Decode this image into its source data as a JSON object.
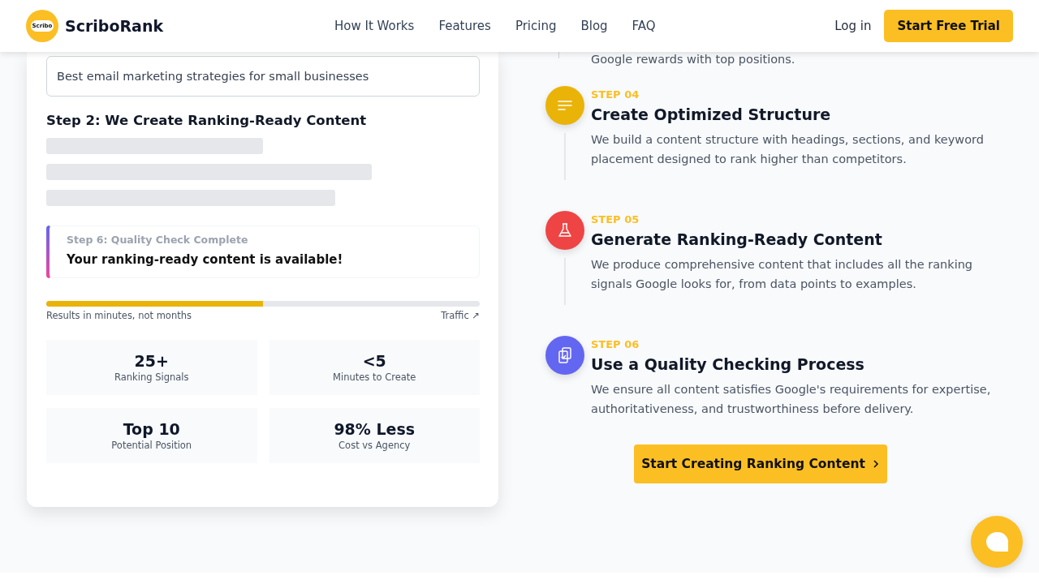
{
  "header": {
    "logo_badge": "Scribo",
    "brand": "ScriboRank",
    "nav": [
      "How It Works",
      "Features",
      "Pricing",
      "Blog",
      "FAQ"
    ],
    "login": "Log in",
    "cta": "Start Free Trial"
  },
  "demo": {
    "query": "Best email marketing strategies for small businesses",
    "step_title": "Step 2: We Create Ranking-Ready Content",
    "notice": {
      "label": "Step 6: Quality Check Complete",
      "message": "Your ranking-ready content is available!"
    },
    "progress": {
      "level": 0.5,
      "caption": "Results in minutes, not months",
      "end_label": "Traffic ↗"
    },
    "stats": [
      {
        "value": "25+",
        "label": "Ranking Signals"
      },
      {
        "value": "<5",
        "label": "Minutes to Create"
      },
      {
        "value": "Top 10",
        "label": "Potential Position"
      },
      {
        "value": "98% Less",
        "label": "Cost vs Agency"
      }
    ]
  },
  "steps_cut_text": "Google rewards with top positions.",
  "steps": [
    {
      "kind": "lines",
      "color": "#eab308",
      "step": "STEP 04",
      "title": "Create Optimized Structure",
      "text": "We build a content structure with headings, sections, and keyword placement designed to rank higher than competitors."
    },
    {
      "kind": "flask",
      "color": "#ef4444",
      "step": "STEP 05",
      "title": "Generate Ranking-Ready Content",
      "text": "We produce comprehensive content that includes all the ranking signals Google looks for, from data points to examples."
    },
    {
      "kind": "clipboard",
      "color": "#6366f1",
      "step": "STEP 06",
      "title": "Use a Quality Checking Process",
      "text": "We ensure all content satisfies Google's requirements for expertise, authoritativeness, and trustworthiness before delivery."
    }
  ],
  "cta": "Start Creating Ranking Content"
}
